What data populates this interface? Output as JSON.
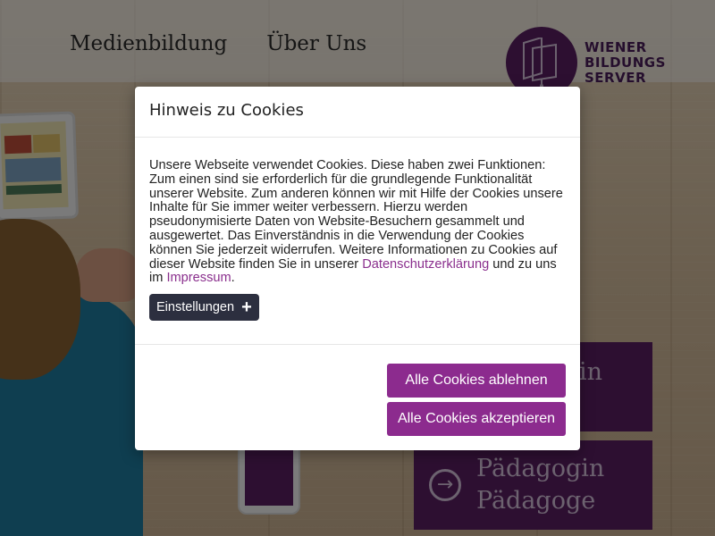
{
  "nav": {
    "items": [
      "Medienbildung",
      "Über Uns"
    ]
  },
  "logo": {
    "line1": "WIENER",
    "line2": "BILDUNGS",
    "line3": "SERVER",
    "color": "#5a1f63"
  },
  "tiles": {
    "tile1_text": "in",
    "tile2_line1": "Pädagogin",
    "tile2_line2": "Pädagoge",
    "tile2_icon": "arrow-right-circle-icon"
  },
  "modal": {
    "title": "Hinweis zu Cookies",
    "text_main": "Unsere Webseite verwendet Cookies. Diese haben zwei Funktionen: Zum einen sind sie erforderlich für die grundlegende Funktionalität unserer Website. Zum anderen können wir mit Hilfe der Cookies unsere Inhalte für Sie immer weiter verbessern. Hierzu werden pseudonymisierte Daten von Website-Besuchern gesammelt und ausgewertet. Das Einverständnis in die Verwendung der Cookies können Sie jederzeit widerrufen. Weitere Informationen zu Cookies auf dieser Website finden Sie in unserer ",
    "privacy_link": "Datenschutzerklärung",
    "text_mid": " und zu uns im ",
    "imprint_link": "Impressum",
    "text_end": ".",
    "settings_label": "Einstellungen",
    "settings_icon": "plus-icon",
    "reject_label": "Alle Cookies ablehnen",
    "accept_label": "Alle Cookies akzeptieren",
    "accent_color": "#8c2b8e"
  }
}
